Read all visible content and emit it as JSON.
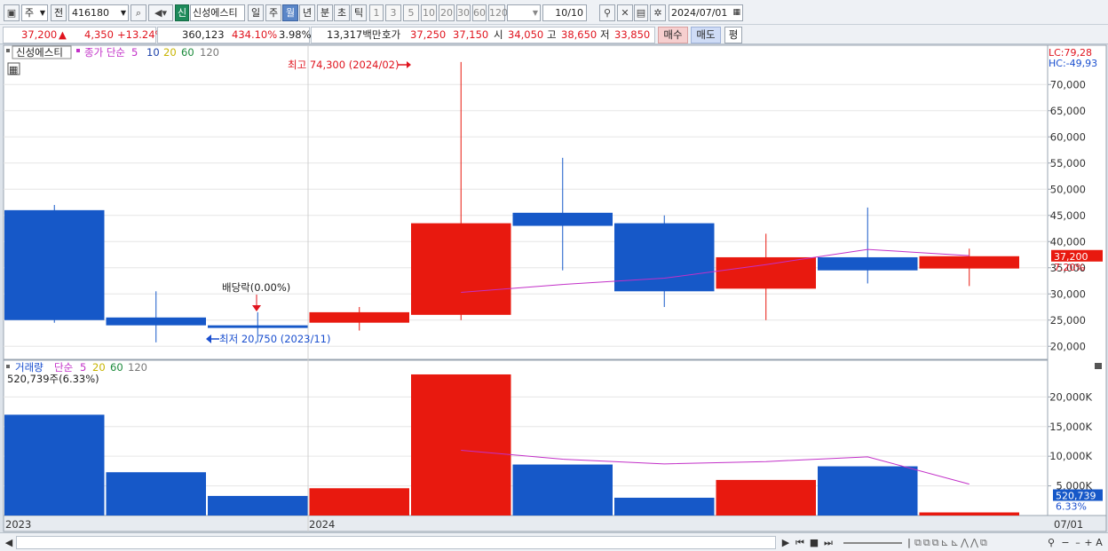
{
  "toolbar": {
    "period_label": "주",
    "prev_label": "전",
    "code": "416180",
    "badge": "신",
    "name": "신성에스티",
    "periods": [
      "일",
      "주",
      "월",
      "년",
      "분",
      "초",
      "틱"
    ],
    "active_period": "월",
    "intervals": [
      "1",
      "3",
      "5",
      "10",
      "20",
      "30",
      "60",
      "120"
    ],
    "count": "10/10",
    "date": "2024/07/01"
  },
  "quote": {
    "price": "37,200",
    "change_arrow": "▲",
    "change": "4,350",
    "change_pct": "+13.24%",
    "volume": "360,123",
    "volume_ratio": "434.10%",
    "turnover": "3.98%",
    "amount": "13,317백만",
    "ask_label": "호가",
    "ask": "37,250",
    "bid": "37,150",
    "open_label": "시",
    "open": "34,050",
    "high_label": "고",
    "high": "38,650",
    "low_label": "저",
    "low": "33,850",
    "buy_label": "매수",
    "sell_label": "매도",
    "eval_label": "평"
  },
  "colors": {
    "up": "#e8190f",
    "down": "#1658c8",
    "ma5": "#c230c8",
    "ma10": "#1a3fa8",
    "ma20": "#c8b400",
    "ma60": "#1a8a3a",
    "ma120": "#777777"
  },
  "chart_data": {
    "type": "candlestick",
    "title": "신성에스티",
    "legend": [
      {
        "name": "종가 단순",
        "color": "#c230c8"
      },
      {
        "name": "5",
        "color": "#c230c8"
      },
      {
        "name": "10",
        "color": "#1a3fa8"
      },
      {
        "name": "20",
        "color": "#c8b400"
      },
      {
        "name": "60",
        "color": "#1a8a3a"
      },
      {
        "name": "120",
        "color": "#777777"
      }
    ],
    "candles": [
      {
        "open": 46000,
        "high": 47000,
        "low": 24500,
        "close": 25000
      },
      {
        "open": 25500,
        "high": 30500,
        "low": 20750,
        "close": 24000
      },
      {
        "open": 24000,
        "high": 26500,
        "low": 20750,
        "close": 23500
      },
      {
        "open": 24500,
        "high": 27500,
        "low": 23000,
        "close": 26500
      },
      {
        "open": 26000,
        "high": 74300,
        "low": 25000,
        "close": 43500
      },
      {
        "open": 45500,
        "high": 56000,
        "low": 34500,
        "close": 43000
      },
      {
        "open": 43500,
        "high": 45000,
        "low": 27500,
        "close": 30500
      },
      {
        "open": 31000,
        "high": 41500,
        "low": 25000,
        "close": 37000
      },
      {
        "open": 37000,
        "high": 46500,
        "low": 32000,
        "close": 34500
      },
      {
        "open": 34850,
        "high": 38650,
        "low": 31500,
        "close": 37200
      }
    ],
    "ma5": [
      null,
      null,
      null,
      null,
      30300,
      31800,
      33000,
      35600,
      38500,
      37300
    ],
    "ylim": [
      17500,
      77500
    ],
    "yticks": [
      "20,000",
      "25,000",
      "30,000",
      "35,000",
      "40,000",
      "45,000",
      "50,000",
      "55,000",
      "60,000",
      "65,000",
      "70,000"
    ],
    "ytick_values": [
      20000,
      25000,
      30000,
      35000,
      40000,
      45000,
      50000,
      55000,
      60000,
      65000,
      70000
    ],
    "lc": "LC:79,28",
    "hc": "HC:-49,93",
    "price_tag": "37,200",
    "price_tag_pct": "7.20%",
    "annotations": {
      "high": "최고 74,300 (2024/02)",
      "low": "최저 20,750 (2023/11)",
      "dividend": "배당락(0.00%)"
    },
    "xlabels": [
      "2023",
      "2024",
      "07/01"
    ],
    "volume": {
      "title": "거래량",
      "legend": [
        {
          "name": "단순",
          "color": "#c230c8"
        },
        {
          "name": "5",
          "color": "#c230c8"
        },
        {
          "name": "20",
          "color": "#c8b400"
        },
        {
          "name": "60",
          "color": "#1a8a3a"
        },
        {
          "name": "120",
          "color": "#777777"
        }
      ],
      "current": "520,739주(6.33%)",
      "values": [
        17000000,
        7300000,
        3300000,
        4600000,
        23800000,
        8600000,
        3000000,
        6000000,
        8300000,
        520739
      ],
      "ma5": [
        null,
        null,
        null,
        null,
        11000000,
        9500000,
        8700000,
        9100000,
        9900000,
        5300000
      ],
      "ylim": [
        0,
        25000000
      ],
      "yticks": [
        "5,000K",
        "10,000K",
        "15,000K",
        "20,000K"
      ],
      "ytick_values": [
        5000000,
        10000000,
        15000000,
        20000000
      ],
      "tag": "520,739",
      "tag_pct": "6.33%"
    }
  }
}
